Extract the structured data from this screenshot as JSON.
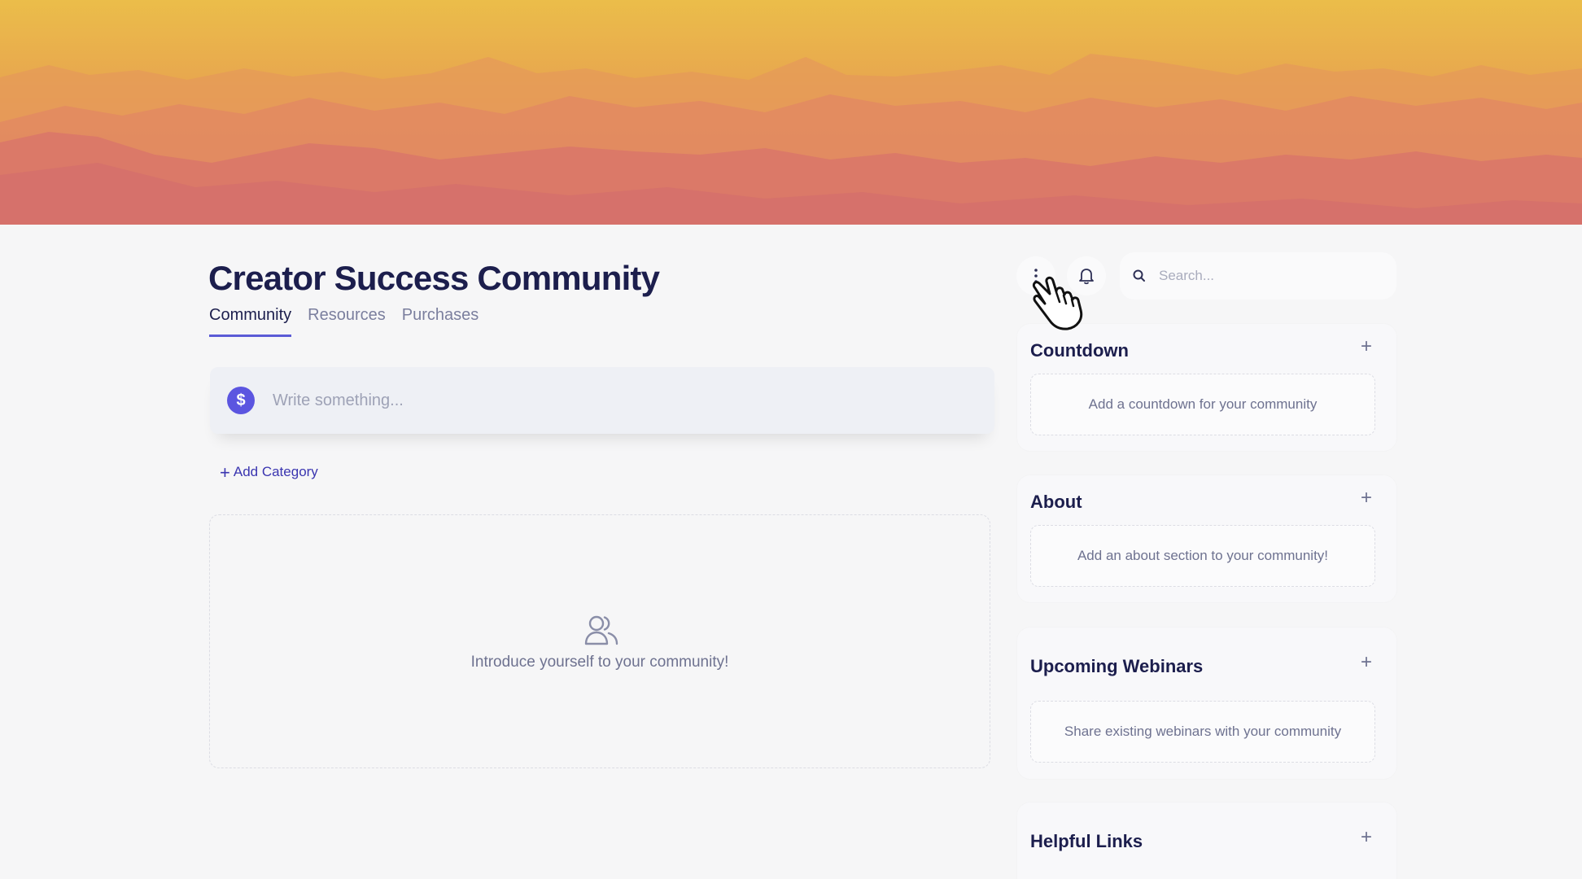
{
  "community": {
    "title": "Creator Success Community",
    "tabs": [
      "Community",
      "Resources",
      "Purchases"
    ],
    "active_tab": "Community"
  },
  "composer": {
    "avatar_symbol": "$",
    "placeholder": "Write something..."
  },
  "feed": {
    "add_category_label": "Add Category",
    "empty_message": "Introduce yourself to your community!",
    "empty_icon": "people-icon"
  },
  "header_actions": {
    "more_icon": "more-vertical-icon",
    "notification_icon": "bell-icon",
    "search_placeholder": "Search..."
  },
  "widgets": [
    {
      "title": "Countdown",
      "empty_text": "Add a countdown for your community"
    },
    {
      "title": "About",
      "empty_text": "Add an about section to your community!"
    },
    {
      "title": "Upcoming Webinars",
      "empty_text": "Share existing webinars with your community"
    },
    {
      "title": "Helpful Links",
      "empty_text": ""
    }
  ],
  "colors": {
    "accent": "#5b5bd6",
    "title": "#1c1e4d",
    "link": "#3a35b0",
    "avatar": "#5b55e0"
  }
}
